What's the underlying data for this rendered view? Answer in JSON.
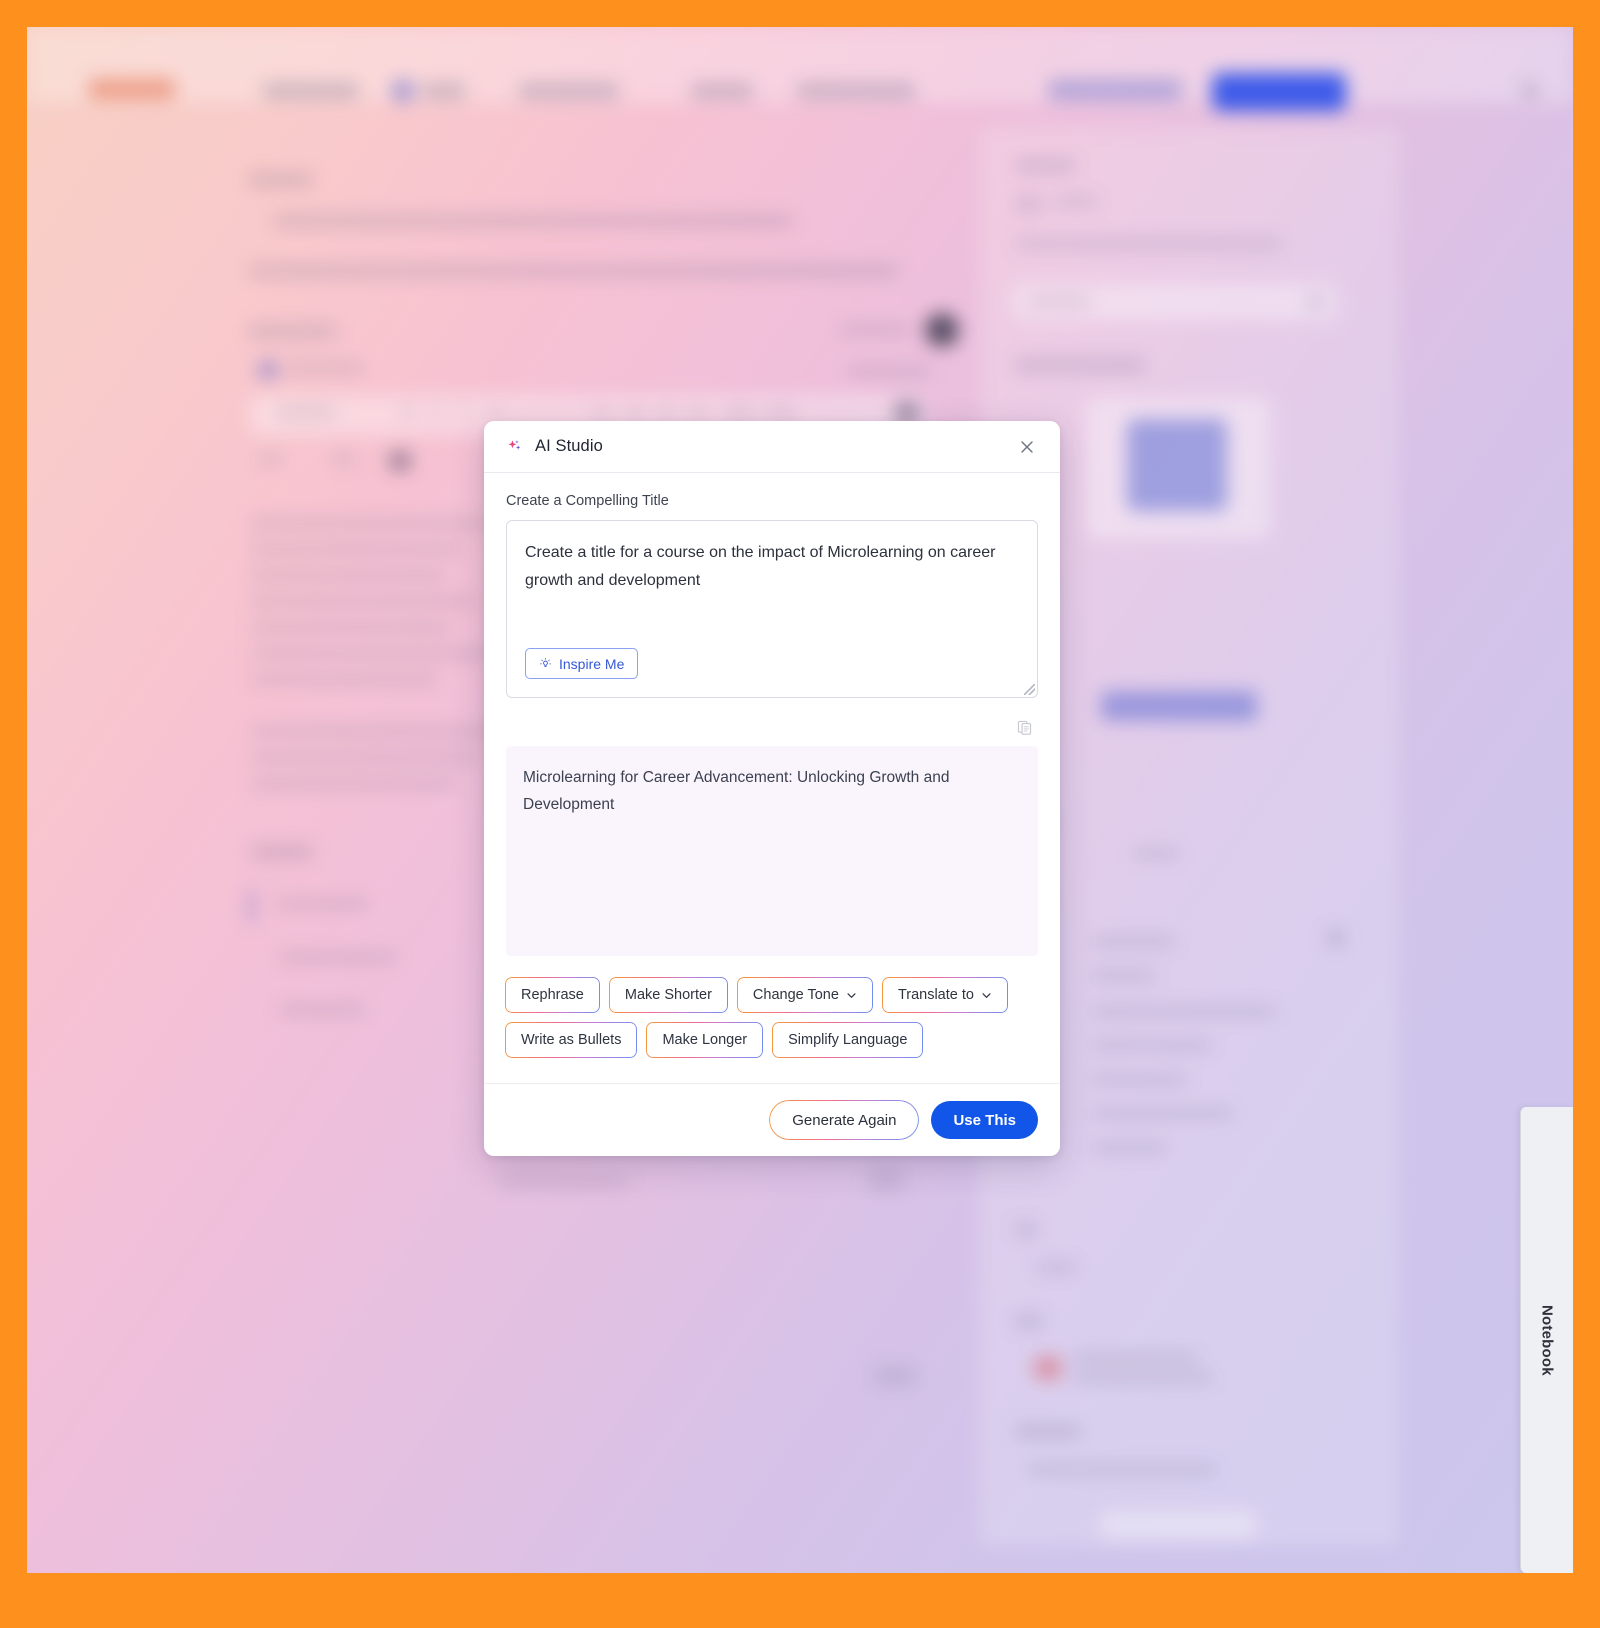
{
  "theme": {
    "frame_color": "#FE8A10",
    "primary_button_color": "#1156E8",
    "accent_link_color": "#3558D4",
    "result_background": "#FAF5FD"
  },
  "background_app": {
    "side_rail_label": "Notebook"
  },
  "modal": {
    "icon": "sparkle-icon",
    "title": "AI Studio",
    "close_icon": "close-icon",
    "prompt": {
      "label": "Create a Compelling Title",
      "value": "Create a title for a course on the impact of Microlearning on career growth and development",
      "placeholder": "Describe what you want to create",
      "inspire_button": {
        "label": "Inspire Me",
        "icon": "lightbulb-icon"
      }
    },
    "result": {
      "copy_icon": "copy-icon",
      "text": "Microlearning for Career Advancement: Unlocking Growth and Development"
    },
    "action_chips": [
      {
        "label": "Rephrase",
        "has_caret": false
      },
      {
        "label": "Make Shorter",
        "has_caret": false
      },
      {
        "label": "Change Tone",
        "has_caret": true
      },
      {
        "label": "Translate to",
        "has_caret": true
      },
      {
        "label": "Write as Bullets",
        "has_caret": false
      },
      {
        "label": "Make Longer",
        "has_caret": false
      },
      {
        "label": "Simplify Language",
        "has_caret": false
      }
    ],
    "footer": {
      "generate_again": "Generate Again",
      "use_this": "Use This"
    }
  }
}
